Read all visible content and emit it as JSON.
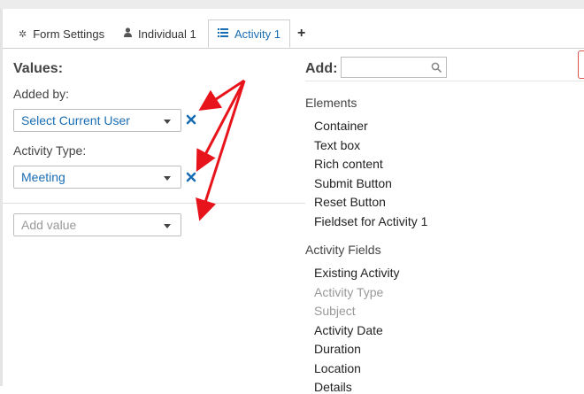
{
  "tabs": [
    {
      "label": "Form Settings",
      "icon": "gear-icon"
    },
    {
      "label": "Individual 1",
      "icon": "person-icon"
    },
    {
      "label": "Activity 1",
      "icon": "list-icon"
    }
  ],
  "add_tab_icon": "plus-icon",
  "values_heading": "Values:",
  "added_by_label": "Added by:",
  "added_by_value": "Select Current User",
  "activity_type_label": "Activity Type:",
  "activity_type_value": "Meeting",
  "add_value_placeholder": "Add value",
  "add_heading": "Add:",
  "elements_heading": "Elements",
  "elements": [
    "Container",
    "Text box",
    "Rich content",
    "Submit Button",
    "Reset Button",
    "Fieldset for Activity 1"
  ],
  "activity_fields_heading": "Activity Fields",
  "activity_fields": [
    {
      "label": "Existing Activity",
      "disabled": false
    },
    {
      "label": "Activity Type",
      "disabled": true
    },
    {
      "label": "Subject",
      "disabled": true
    },
    {
      "label": "Activity Date",
      "disabled": false
    },
    {
      "label": "Duration",
      "disabled": false
    },
    {
      "label": "Location",
      "disabled": false
    },
    {
      "label": "Details",
      "disabled": false
    }
  ],
  "colors": {
    "accent": "#1a6db3",
    "annotation_arrow": "#e8141b"
  }
}
